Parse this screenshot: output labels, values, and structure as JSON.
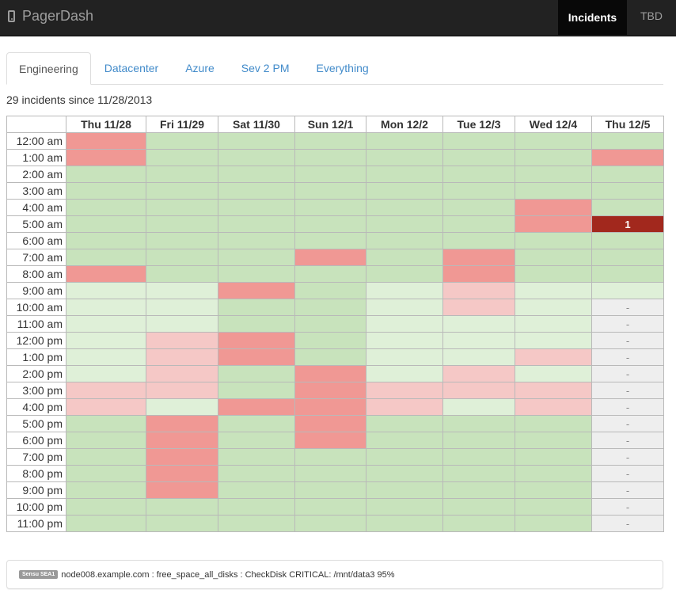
{
  "navbar": {
    "brand": "PagerDash",
    "brand_icon": "phone-icon",
    "items": [
      {
        "label": "Incidents",
        "active": true
      },
      {
        "label": "TBD",
        "active": false
      }
    ]
  },
  "tabs": [
    {
      "label": "Engineering",
      "active": true
    },
    {
      "label": "Datacenter",
      "active": false
    },
    {
      "label": "Azure",
      "active": false
    },
    {
      "label": "Sev 2 PM",
      "active": false
    },
    {
      "label": "Everything",
      "active": false
    }
  ],
  "summary": "29 incidents since 11/28/2013",
  "colors": {
    "none": "#c8e3bc",
    "incident": "#f09894",
    "none_light": "#dff0d8",
    "incident_light": "#f5c8c6",
    "current": "#a2281d",
    "future": "#eeeeee"
  },
  "grid": {
    "columns": [
      "Thu 11/28",
      "Fri 11/29",
      "Sat 11/30",
      "Sun 12/1",
      "Mon 12/2",
      "Tue 12/3",
      "Wed 12/4",
      "Thu 12/5"
    ],
    "rows": [
      {
        "hour": "12:00 am",
        "cells": [
          {
            "s": 1
          },
          {
            "s": 0
          },
          {
            "s": 0
          },
          {
            "s": 0
          },
          {
            "s": 0
          },
          {
            "s": 0
          },
          {
            "s": 0
          },
          {
            "s": 0
          }
        ]
      },
      {
        "hour": "1:00 am",
        "cells": [
          {
            "s": 1
          },
          {
            "s": 0
          },
          {
            "s": 0
          },
          {
            "s": 0
          },
          {
            "s": 0
          },
          {
            "s": 0
          },
          {
            "s": 0
          },
          {
            "s": 1
          }
        ]
      },
      {
        "hour": "2:00 am",
        "cells": [
          {
            "s": 0
          },
          {
            "s": 0
          },
          {
            "s": 0
          },
          {
            "s": 0
          },
          {
            "s": 0
          },
          {
            "s": 0
          },
          {
            "s": 0
          },
          {
            "s": 0
          }
        ]
      },
      {
        "hour": "3:00 am",
        "cells": [
          {
            "s": 0
          },
          {
            "s": 0
          },
          {
            "s": 0
          },
          {
            "s": 0
          },
          {
            "s": 0
          },
          {
            "s": 0
          },
          {
            "s": 0
          },
          {
            "s": 0
          }
        ]
      },
      {
        "hour": "4:00 am",
        "cells": [
          {
            "s": 0
          },
          {
            "s": 0
          },
          {
            "s": 0
          },
          {
            "s": 0
          },
          {
            "s": 0
          },
          {
            "s": 0
          },
          {
            "s": 1
          },
          {
            "s": 0
          }
        ]
      },
      {
        "hour": "5:00 am",
        "cells": [
          {
            "s": 0
          },
          {
            "s": 0
          },
          {
            "s": 0
          },
          {
            "s": 0
          },
          {
            "s": 0
          },
          {
            "s": 0
          },
          {
            "s": 1
          },
          {
            "s": 4,
            "text": "1"
          }
        ]
      },
      {
        "hour": "6:00 am",
        "cells": [
          {
            "s": 0
          },
          {
            "s": 0
          },
          {
            "s": 0
          },
          {
            "s": 0
          },
          {
            "s": 0
          },
          {
            "s": 0
          },
          {
            "s": 0
          },
          {
            "s": 0
          }
        ]
      },
      {
        "hour": "7:00 am",
        "cells": [
          {
            "s": 0
          },
          {
            "s": 0
          },
          {
            "s": 0
          },
          {
            "s": 1
          },
          {
            "s": 0
          },
          {
            "s": 1
          },
          {
            "s": 0
          },
          {
            "s": 0
          }
        ]
      },
      {
        "hour": "8:00 am",
        "cells": [
          {
            "s": 1
          },
          {
            "s": 0
          },
          {
            "s": 0
          },
          {
            "s": 0
          },
          {
            "s": 0
          },
          {
            "s": 1
          },
          {
            "s": 0
          },
          {
            "s": 0
          }
        ]
      },
      {
        "hour": "9:00 am",
        "cells": [
          {
            "s": 2
          },
          {
            "s": 2
          },
          {
            "s": 1
          },
          {
            "s": 0
          },
          {
            "s": 2
          },
          {
            "s": 3
          },
          {
            "s": 2
          },
          {
            "s": 2
          }
        ]
      },
      {
        "hour": "10:00 am",
        "cells": [
          {
            "s": 2
          },
          {
            "s": 2
          },
          {
            "s": 0
          },
          {
            "s": 0
          },
          {
            "s": 2
          },
          {
            "s": 3
          },
          {
            "s": 2
          },
          {
            "s": 5,
            "text": "-"
          }
        ]
      },
      {
        "hour": "11:00 am",
        "cells": [
          {
            "s": 2
          },
          {
            "s": 2
          },
          {
            "s": 0
          },
          {
            "s": 0
          },
          {
            "s": 2
          },
          {
            "s": 2
          },
          {
            "s": 2
          },
          {
            "s": 5,
            "text": "-"
          }
        ]
      },
      {
        "hour": "12:00 pm",
        "cells": [
          {
            "s": 2
          },
          {
            "s": 3
          },
          {
            "s": 1
          },
          {
            "s": 0
          },
          {
            "s": 2
          },
          {
            "s": 2
          },
          {
            "s": 2
          },
          {
            "s": 5,
            "text": "-"
          }
        ]
      },
      {
        "hour": "1:00 pm",
        "cells": [
          {
            "s": 2
          },
          {
            "s": 3
          },
          {
            "s": 1
          },
          {
            "s": 0
          },
          {
            "s": 2
          },
          {
            "s": 2
          },
          {
            "s": 3
          },
          {
            "s": 5,
            "text": "-"
          }
        ]
      },
      {
        "hour": "2:00 pm",
        "cells": [
          {
            "s": 2
          },
          {
            "s": 3
          },
          {
            "s": 0
          },
          {
            "s": 1
          },
          {
            "s": 2
          },
          {
            "s": 3
          },
          {
            "s": 2
          },
          {
            "s": 5,
            "text": "-"
          }
        ]
      },
      {
        "hour": "3:00 pm",
        "cells": [
          {
            "s": 3
          },
          {
            "s": 3
          },
          {
            "s": 0
          },
          {
            "s": 1
          },
          {
            "s": 3
          },
          {
            "s": 3
          },
          {
            "s": 3
          },
          {
            "s": 5,
            "text": "-"
          }
        ]
      },
      {
        "hour": "4:00 pm",
        "cells": [
          {
            "s": 3
          },
          {
            "s": 2
          },
          {
            "s": 1
          },
          {
            "s": 1
          },
          {
            "s": 3
          },
          {
            "s": 2
          },
          {
            "s": 3
          },
          {
            "s": 5,
            "text": "-"
          }
        ]
      },
      {
        "hour": "5:00 pm",
        "cells": [
          {
            "s": 0
          },
          {
            "s": 1
          },
          {
            "s": 0
          },
          {
            "s": 1
          },
          {
            "s": 0
          },
          {
            "s": 0
          },
          {
            "s": 0
          },
          {
            "s": 5,
            "text": "-"
          }
        ]
      },
      {
        "hour": "6:00 pm",
        "cells": [
          {
            "s": 0
          },
          {
            "s": 1
          },
          {
            "s": 0
          },
          {
            "s": 1
          },
          {
            "s": 0
          },
          {
            "s": 0
          },
          {
            "s": 0
          },
          {
            "s": 5,
            "text": "-"
          }
        ]
      },
      {
        "hour": "7:00 pm",
        "cells": [
          {
            "s": 0
          },
          {
            "s": 1
          },
          {
            "s": 0
          },
          {
            "s": 0
          },
          {
            "s": 0
          },
          {
            "s": 0
          },
          {
            "s": 0
          },
          {
            "s": 5,
            "text": "-"
          }
        ]
      },
      {
        "hour": "8:00 pm",
        "cells": [
          {
            "s": 0
          },
          {
            "s": 1
          },
          {
            "s": 0
          },
          {
            "s": 0
          },
          {
            "s": 0
          },
          {
            "s": 0
          },
          {
            "s": 0
          },
          {
            "s": 5,
            "text": "-"
          }
        ]
      },
      {
        "hour": "9:00 pm",
        "cells": [
          {
            "s": 0
          },
          {
            "s": 1
          },
          {
            "s": 0
          },
          {
            "s": 0
          },
          {
            "s": 0
          },
          {
            "s": 0
          },
          {
            "s": 0
          },
          {
            "s": 5,
            "text": "-"
          }
        ]
      },
      {
        "hour": "10:00 pm",
        "cells": [
          {
            "s": 0
          },
          {
            "s": 0
          },
          {
            "s": 0
          },
          {
            "s": 0
          },
          {
            "s": 0
          },
          {
            "s": 0
          },
          {
            "s": 0
          },
          {
            "s": 5,
            "text": "-"
          }
        ]
      },
      {
        "hour": "11:00 pm",
        "cells": [
          {
            "s": 0
          },
          {
            "s": 0
          },
          {
            "s": 0
          },
          {
            "s": 0
          },
          {
            "s": 0
          },
          {
            "s": 0
          },
          {
            "s": 0
          },
          {
            "s": 5,
            "text": "-"
          }
        ]
      }
    ]
  },
  "incident_panel": {
    "badge": "Sensu SEA1",
    "message": "node008.example.com : free_space_all_disks : CheckDisk CRITICAL: /mnt/data3 95%"
  }
}
